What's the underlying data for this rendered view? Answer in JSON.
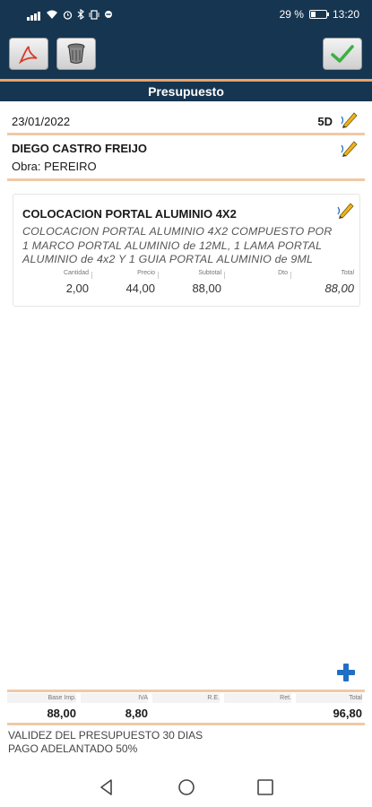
{
  "status_bar": {
    "battery": "29 %",
    "time": "13:20",
    "battery_level": 0.29
  },
  "toolbar": {
    "pdf_icon": "pdf-icon",
    "delete_icon": "trash-icon",
    "confirm_icon": "check-icon"
  },
  "title": "Presupuesto",
  "header": {
    "date": "23/01/2022",
    "days": "5D"
  },
  "client": {
    "name": "DIEGO CASTRO FREIJO",
    "obra": "Obra: PEREIRO"
  },
  "item": {
    "title": "COLOCACION PORTAL ALUMINIO 4X2",
    "description": "COLOCACION PORTAL ALUMINIO 4X2 COMPUESTO POR 1 MARCO PORTAL ALUMINIO de 12ML, 1 LAMA PORTAL ALUMINIO de 4x2 Y 1 GUIA PORTAL ALUMINIO de 9ML",
    "labels": {
      "cantidad": "Cantidad",
      "precio": "Precio",
      "subtotal": "Subtotal",
      "dto": "Dto",
      "total": "Total"
    },
    "values": {
      "cantidad": "2,00",
      "precio": "44,00",
      "subtotal": "88,00",
      "dto": "",
      "total": "88,00"
    }
  },
  "totals": {
    "labels": {
      "base": "Base Imp.",
      "iva": "IVA",
      "re": "R.E.",
      "ret": "Ret.",
      "total": "Total"
    },
    "values": {
      "base": "88,00",
      "iva": "8,80",
      "re": "",
      "ret": "",
      "total": "96,80"
    }
  },
  "notes": {
    "line1": "VALIDEZ DEL PRESUPUESTO 30 DIAS",
    "line2": "PAGO ADELANTADO 50%"
  },
  "colors": {
    "bar": "#163550",
    "accent": "#e8a36b",
    "check": "#3cb043",
    "plus": "#1f6fc5"
  }
}
